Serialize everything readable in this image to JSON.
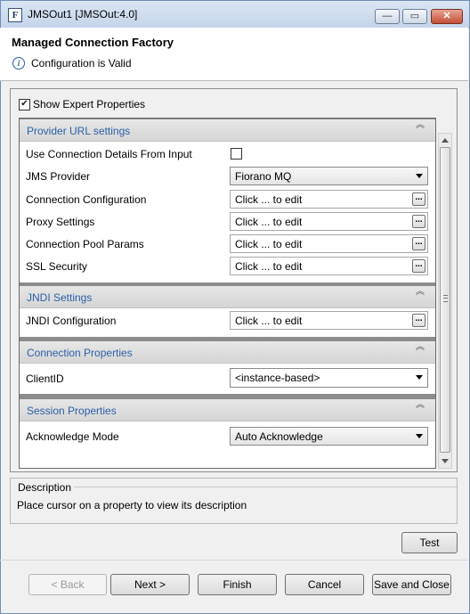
{
  "window": {
    "title": "JMSOut1 [JMSOut:4.0]",
    "app_icon_letter": "F",
    "minimize_glyph": "—",
    "maximize_glyph": "▭",
    "close_glyph": "✕"
  },
  "header": {
    "title": "Managed Connection Factory",
    "status": "Configuration is Valid",
    "info_glyph": "i"
  },
  "expert": {
    "label": "Show Expert Properties",
    "checked": true,
    "check_glyph": "✔"
  },
  "sections": {
    "provider": {
      "title": "Provider URL settings",
      "rows": {
        "use_conn": {
          "label": "Use Connection Details From Input"
        },
        "jms_provider": {
          "label": "JMS Provider",
          "value": "Fiorano MQ"
        },
        "conn_config": {
          "label": "Connection Configuration",
          "value": "Click ... to edit"
        },
        "proxy": {
          "label": "Proxy Settings",
          "value": "Click ... to edit"
        },
        "pool": {
          "label": "Connection Pool Params",
          "value": "Click ... to edit"
        },
        "ssl": {
          "label": "SSL Security",
          "value": "Click ... to edit"
        }
      }
    },
    "jndi": {
      "title": "JNDI Settings",
      "rows": {
        "jndi_config": {
          "label": "JNDI Configuration",
          "value": "Click ... to edit"
        }
      }
    },
    "conn_props": {
      "title": "Connection Properties",
      "rows": {
        "client_id": {
          "label": "ClientID",
          "value": "<instance-based>"
        }
      }
    },
    "session": {
      "title": "Session Properties",
      "rows": {
        "ack_mode": {
          "label": "Acknowledge Mode",
          "value": "Auto Acknowledge"
        }
      }
    }
  },
  "glyphs": {
    "ellipsis": "...",
    "collapse": "︽"
  },
  "description": {
    "title": "Description",
    "text": "Place cursor on a property to view its description"
  },
  "buttons": {
    "test": "Test",
    "back": "< Back",
    "next": "Next >",
    "finish": "Finish",
    "cancel": "Cancel",
    "save_close": "Save and Close"
  }
}
